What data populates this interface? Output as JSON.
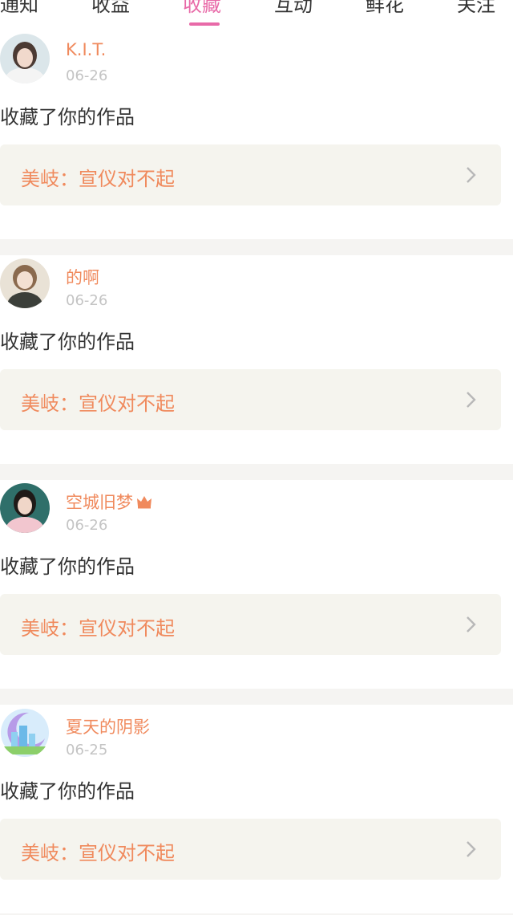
{
  "tabs": [
    {
      "label": "通知",
      "active": false
    },
    {
      "label": "收益",
      "active": false
    },
    {
      "label": "收藏",
      "active": true
    },
    {
      "label": "互动",
      "active": false
    },
    {
      "label": "鲜花",
      "active": false
    },
    {
      "label": "关注",
      "active": false
    }
  ],
  "colors": {
    "accent": "#e86aa8",
    "name": "#f08a5d",
    "date": "#c4c4c4"
  },
  "items": [
    {
      "username": "K.I.T.",
      "date": "06-26",
      "action": "收藏了你的作品",
      "work": "美岐：宣仪对不起",
      "badge_icon": ""
    },
    {
      "username": "的啊",
      "date": "06-26",
      "action": "收藏了你的作品",
      "work": "美岐：宣仪对不起",
      "badge_icon": ""
    },
    {
      "username": "空城旧梦",
      "date": "06-26",
      "action": "收藏了你的作品",
      "work": "美岐：宣仪对不起",
      "badge_icon": "crown-icon"
    },
    {
      "username": "夏天的阴影",
      "date": "06-25",
      "action": "收藏了你的作品",
      "work": "美岐：宣仪对不起",
      "badge_icon": ""
    }
  ]
}
